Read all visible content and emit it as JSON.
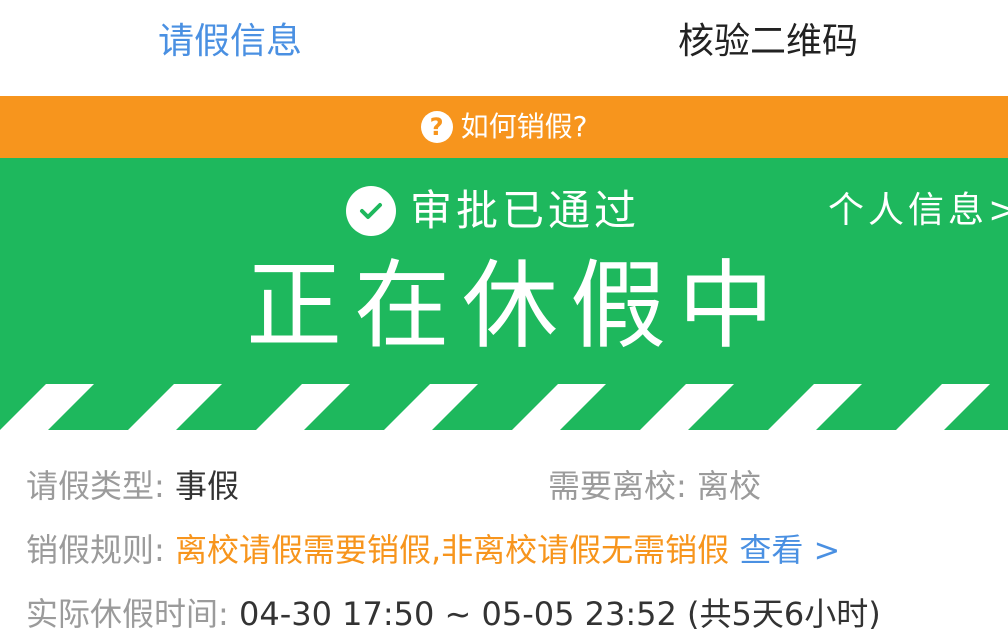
{
  "tabs": [
    {
      "label": "请假信息",
      "active": true
    },
    {
      "label": "核验二维码",
      "active": false
    }
  ],
  "help_bar": {
    "icon": "question-circle-icon",
    "text": "如何销假?",
    "background": "#f7951d"
  },
  "status": {
    "icon": "check-circle-icon",
    "approval": "审批已通过",
    "personal_info_link": "个人信息>",
    "main": "正在休假中",
    "background": "#1eb85d"
  },
  "details": {
    "leave_type_label": "请假类型:",
    "leave_type_value": "事假",
    "leave_school_label": "需要离校:",
    "leave_school_value": "离校",
    "rule_label": "销假规则:",
    "rule_text": "离校请假需要销假,非离校请假无需销假",
    "rule_link": "查看 >",
    "actual_time_label": "实际休假时间:",
    "actual_time_value": "04-30 17:50 ~ 05-05 23:52 (共5天6小时)"
  },
  "colors": {
    "accent_blue": "#4a90e2",
    "warning_orange": "#f7951d",
    "success_green": "#1eb85d"
  }
}
